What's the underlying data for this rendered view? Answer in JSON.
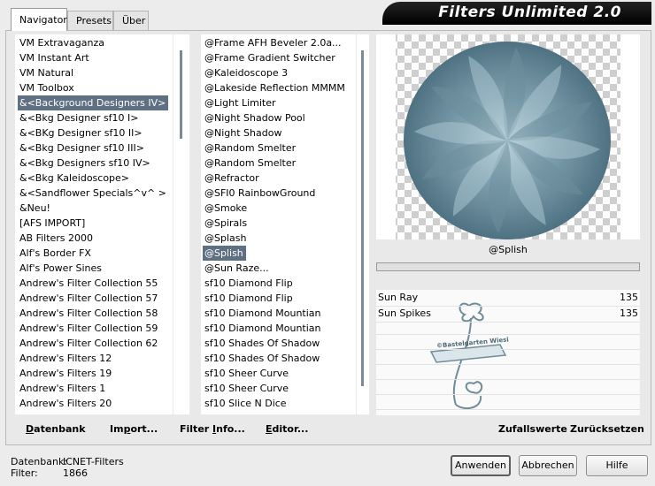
{
  "tabs": [
    {
      "label": "Navigator",
      "active": true
    },
    {
      "label": "Presets",
      "active": false
    },
    {
      "label": "Über",
      "active": false
    }
  ],
  "app_title": "Filters Unlimited 2.0",
  "categories": [
    "VM Extravaganza",
    "VM Instant Art",
    "VM Natural",
    "VM Toolbox",
    "&<Background Designers IV>",
    "&<Bkg Designer sf10 I>",
    "&<BKg Designer sf10 II>",
    "&<Bkg Designer sf10 III>",
    "&<Bkg Designers sf10 IV>",
    "&<Bkg Kaleidoscope>",
    "&<Sandflower Specials^v^ >",
    "&Neu!",
    "[AFS IMPORT]",
    "AB Filters 2000",
    "Alf's Border FX",
    "Alf's Power Sines",
    "Andrew's Filter Collection 55",
    "Andrew's Filter Collection 57",
    "Andrew's Filter Collection 58",
    "Andrew's Filter Collection 59",
    "Andrew's Filter Collection 62",
    "Andrew's Filters 12",
    "Andrew's Filters 19",
    "Andrew's Filters 1",
    "Andrew's Filters 20"
  ],
  "categories_selected_index": 4,
  "filters": [
    "@Frame AFH Beveler 2.0a...",
    "@Frame Gradient Switcher",
    "@Kaleidoscope 3",
    "@Lakeside Reflection MMMM",
    "@Light Limiter",
    "@Night Shadow Pool",
    "@Night Shadow",
    "@Random Smelter",
    "@Random Smelter",
    "@Refractor",
    "@SFI0 RainbowGround",
    "@Smoke",
    "@Spirals",
    "@Splash",
    "@Splish",
    "@Sun Raze...",
    "sf10 Diamond Flip",
    "sf10 Diamond Flip",
    "sf10 Diamond Mountian",
    "sf10 Diamond Mountian",
    "sf10 Shades Of Shadow",
    "sf10 Shades Of Shadow",
    "sf10 Sheer Curve",
    "sf10 Sheer Curve",
    "sf10 Slice N Dice"
  ],
  "filters_selected_index": 14,
  "preview_filter_name": "@Splish",
  "params": [
    {
      "name": "Sun Ray",
      "value": "135"
    },
    {
      "name": "Sun Spikes",
      "value": "135"
    }
  ],
  "watermark_text": "©Bastelgarten Wiesi",
  "bottom_buttons": {
    "datenbank": {
      "ul": "D",
      "rest": "atenbank"
    },
    "import": {
      "pre": "Im",
      "ul": "p",
      "rest": "ort..."
    },
    "filter_info": {
      "pre": "Filter ",
      "ul": "I",
      "rest": "nfo..."
    },
    "editor": {
      "ul": "E",
      "rest": "ditor..."
    },
    "zufallswerte": "Zufallswerte",
    "zuruecksetzen": "Zurücksetzen"
  },
  "status": {
    "db_label": "Datenbank:",
    "db_value": "ICNET-Filters",
    "filter_label": "Filter:",
    "filter_value": "1866"
  },
  "dialog_buttons": {
    "apply": "Anwenden",
    "cancel": "Abbrechen",
    "help": "Hilfe"
  },
  "colors": {
    "selection": "#5f7083",
    "preview_tint": "#7e9fae"
  }
}
